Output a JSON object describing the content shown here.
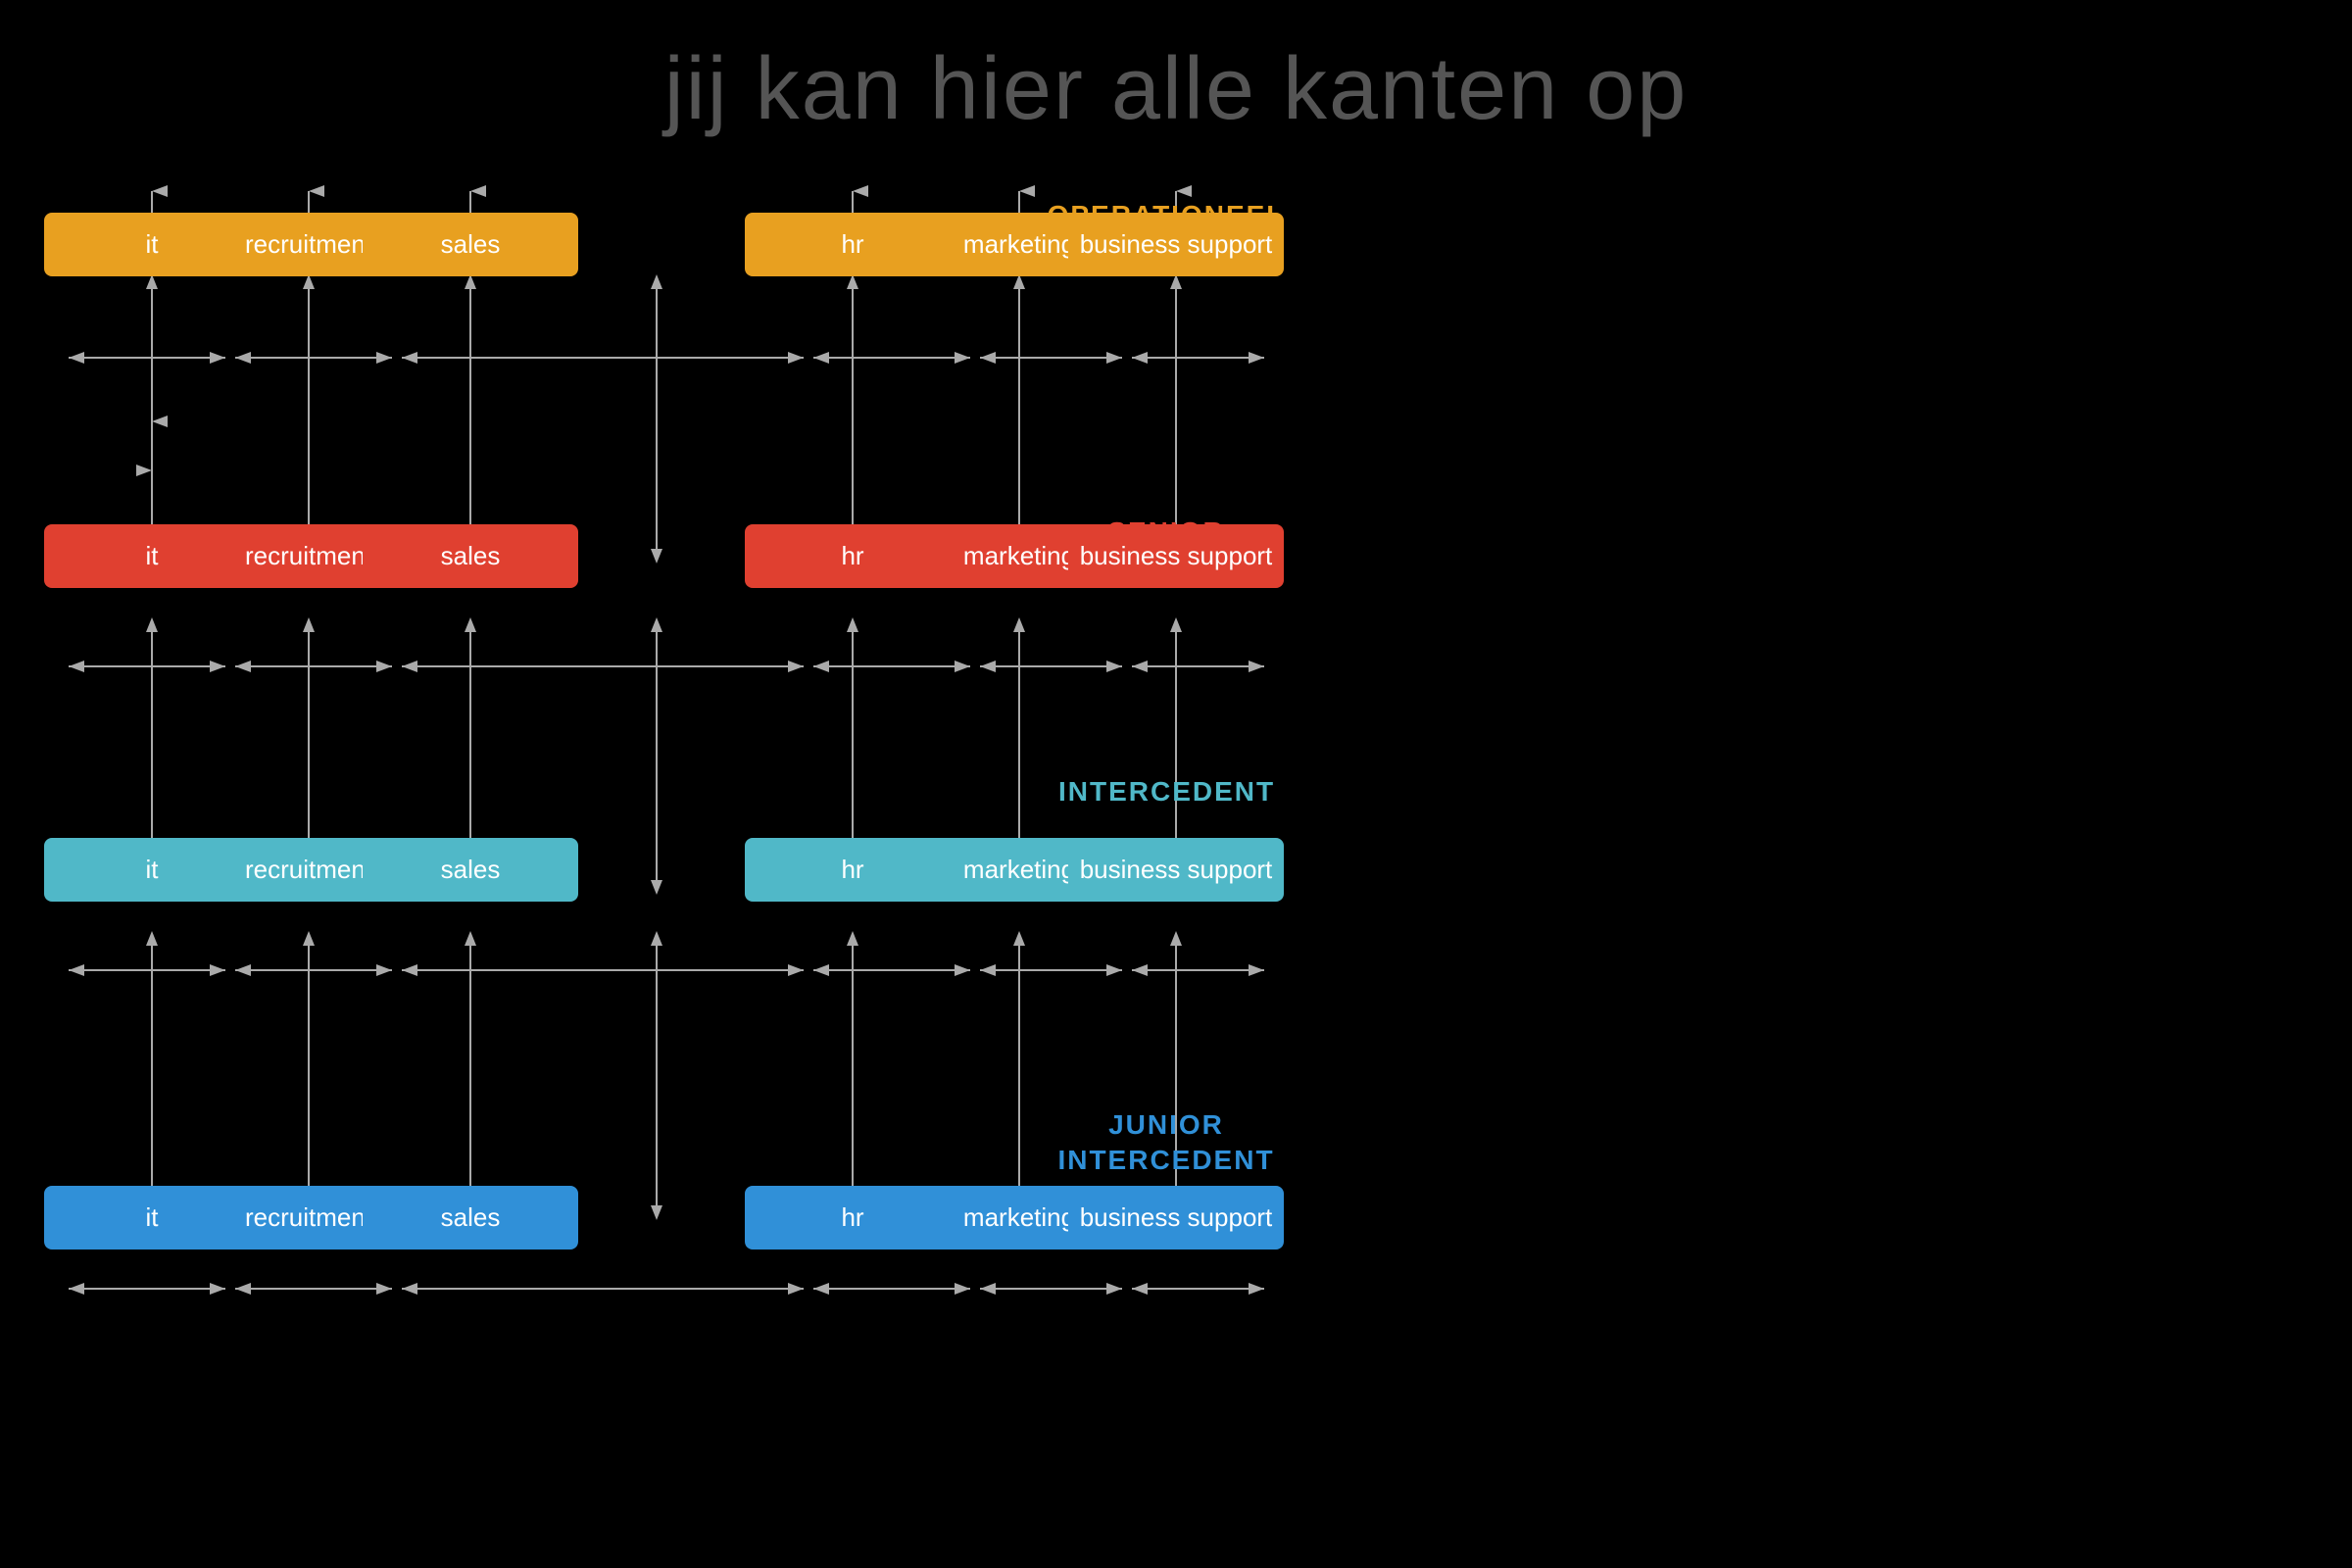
{
  "title": "jij kan hier alle kanten op",
  "roles": {
    "operational": "OPERATIONEEL\nMANAGER",
    "senior": "SENIOR\nINTERCEDENT",
    "intercedent": "INTERCEDENT",
    "junior": "JUNIOR\nINTERCEDENT"
  },
  "levels": [
    {
      "id": "operational",
      "color": "yellow",
      "boxes": [
        "it",
        "recruitment",
        "sales",
        "hr",
        "marketing",
        "business support"
      ]
    },
    {
      "id": "senior",
      "color": "red",
      "boxes": [
        "it",
        "recruitment",
        "sales",
        "hr",
        "marketing",
        "business support"
      ]
    },
    {
      "id": "intercedent",
      "color": "teal",
      "boxes": [
        "it",
        "recruitment",
        "sales",
        "hr",
        "marketing",
        "business support"
      ]
    },
    {
      "id": "junior",
      "color": "blue",
      "boxes": [
        "it",
        "recruitment",
        "sales",
        "hr",
        "marketing",
        "business support"
      ]
    }
  ]
}
